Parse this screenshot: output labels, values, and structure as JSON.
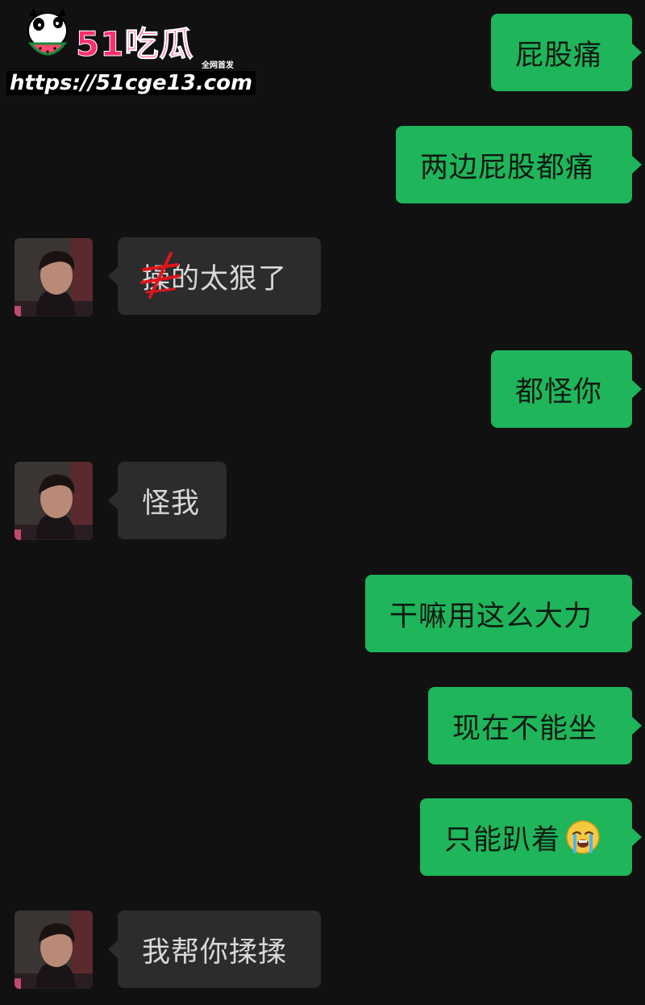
{
  "watermark": {
    "brand": "51吃瓜",
    "tagline": "全网首发",
    "url": "https://51cge13.com"
  },
  "messages": [
    {
      "side": "out",
      "text": "屁股痛"
    },
    {
      "side": "out",
      "text": "两边屁股都痛"
    },
    {
      "side": "in",
      "text": "操的太狠了",
      "scribbled_char": "操"
    },
    {
      "side": "out",
      "text": "都怪你"
    },
    {
      "side": "in",
      "text": "怪我"
    },
    {
      "side": "out",
      "text": "干嘛用这么大力"
    },
    {
      "side": "out",
      "text": "现在不能坐"
    },
    {
      "side": "out",
      "text": "只能趴着",
      "emoji": "crying-face-emoji"
    },
    {
      "side": "in",
      "text": "我帮你揉揉"
    }
  ],
  "colors": {
    "background": "#111111",
    "outgoing_bubble": "#1fb55a",
    "incoming_bubble": "#2c2c2c",
    "brand_pink": "#ff2f6d"
  }
}
